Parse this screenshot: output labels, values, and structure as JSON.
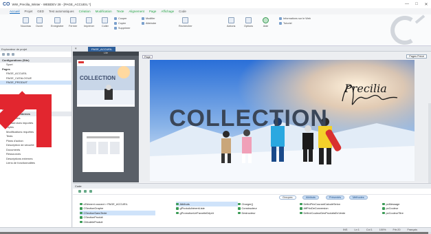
{
  "app": {
    "logo": "CO",
    "title": "WW_Precilia_Winter - WEBDEV 28 - [PAGE_ACCUEIL *]",
    "window_controls": [
      "—",
      "□",
      "✕"
    ]
  },
  "menu": [
    {
      "label": "Accueil",
      "active": true
    },
    {
      "label": "Projet"
    },
    {
      "label": "GED"
    },
    {
      "label": "Test automatiques"
    },
    {
      "label": "Création",
      "green": true
    },
    {
      "label": "Modification",
      "green": true
    },
    {
      "label": "Texte",
      "green": true
    },
    {
      "label": "Alignement",
      "green": true
    },
    {
      "label": "Page",
      "green": true
    },
    {
      "label": "Affichage",
      "green": true
    },
    {
      "label": "Code"
    }
  ],
  "ribbon": {
    "buttons": [
      "Nouveau",
      "Ouvrir",
      "Enregistrer",
      "Fermer",
      "Imprimer"
    ],
    "clipboard": [
      "Coller",
      "Couper",
      "Copier",
      "Supprimer"
    ],
    "search": [
      "Rechercher",
      "Modifier",
      "Atteindre"
    ],
    "right": [
      "Actions",
      "Options",
      "Aide"
    ],
    "info": [
      "Informations sur le Web",
      "Tutoriel"
    ]
  },
  "left_panel": {
    "header": "Explorateur de projet",
    "items": [
      {
        "label": "Configurations (Site)",
        "type": "sec"
      },
      {
        "label": "Sport",
        "type": "item"
      },
      {
        "label": "Pages",
        "type": "bold"
      },
      {
        "label": "PAGE_ACCUEIL",
        "type": "item"
      },
      {
        "label": "PAGE_CATALOGUE",
        "type": "item"
      },
      {
        "label": "PAGE_PRODUIT",
        "type": "sel"
      },
      {
        "label": "",
        "type": "item"
      },
      {
        "label": "",
        "type": "item"
      },
      {
        "label": "",
        "type": "item"
      },
      {
        "label": "",
        "type": "item"
      },
      {
        "label": "",
        "type": "item"
      },
      {
        "label": "Composants",
        "type": "bold"
      },
      {
        "label": "Composants internes",
        "type": "sec"
      },
      {
        "label": "Procédures",
        "type": "item"
      },
      {
        "label": "Webservices importés",
        "type": "item"
      },
      {
        "label": "Styles",
        "type": "item"
      },
      {
        "label": "Modifications requêtes",
        "type": "item"
      },
      {
        "label": "Tests",
        "type": "item"
      },
      {
        "label": "Plans d'action",
        "type": "item"
      },
      {
        "label": "Description de sécurité",
        "type": "item"
      },
      {
        "label": "Documents",
        "type": "item"
      },
      {
        "label": "Ressources",
        "type": "item"
      },
      {
        "label": "Descriptions externes",
        "type": "item"
      },
      {
        "label": "Liens de fonctionnalités",
        "type": "item"
      }
    ]
  },
  "editor": {
    "tab_label": "PAGE_ACCUEIL",
    "thumb_header": "Lite",
    "thumb_title": "COLLECTION",
    "page_label": "Page",
    "ruler_button": "Pages Précé",
    "hero_title": "COLLECTION",
    "signature": "Precilia"
  },
  "bottom_panel": {
    "header": "Code",
    "pills": [
      {
        "label": "Groupes",
        "bg": "#ffffff",
        "fg": "#333333"
      },
      {
        "label": "Attributs",
        "bg": "#c7dcf4",
        "fg": "#1a4a80"
      },
      {
        "label": "Présentés",
        "bg": "#c7dcf4",
        "fg": "#1a4a80"
      },
      {
        "label": "Méthodes",
        "bg": "#c7dcf4",
        "fg": "#1a4a80"
      }
    ],
    "col1": [
      {
        "label": "cElément courant > PAGE_ACCUEIL",
        "sel": false
      },
      {
        "label": "CSectionGraphe",
        "sel": false
      },
      {
        "label": "CSectionSansTexte",
        "sel": true
      },
      {
        "label": "CSectionProduit",
        "sel": false
      },
      {
        "label": "CModèleProduit",
        "sel": false
      }
    ],
    "col2": [
      {
        "label": "Attributs",
        "sel": true
      },
      {
        "label": "gPhotoAdhérentListe",
        "sel": false
      },
      {
        "label": "gPromotionUrlFavoriteDépôt",
        "sel": false
      }
    ],
    "col3": [
      "Charger()",
      "Constructeur",
      "Destructeur"
    ],
    "col4": [
      "DéfiniPrixCourantCalculéSelon",
      "AffPrixDeConversion",
      "DéfinirCouleurDesProduitsEnVente"
    ],
    "col5": [
      "pcMessage",
      "pcCouleur",
      "pcCouleurTitre"
    ]
  },
  "status": [
    "INS",
    "Ln 1",
    "Col 1",
    "100%",
    "Frh:20",
    "Français"
  ],
  "colors": {
    "accent": "#1a6fc0",
    "tab": "#2e5f9a",
    "red_arrow": "#e2262f"
  }
}
